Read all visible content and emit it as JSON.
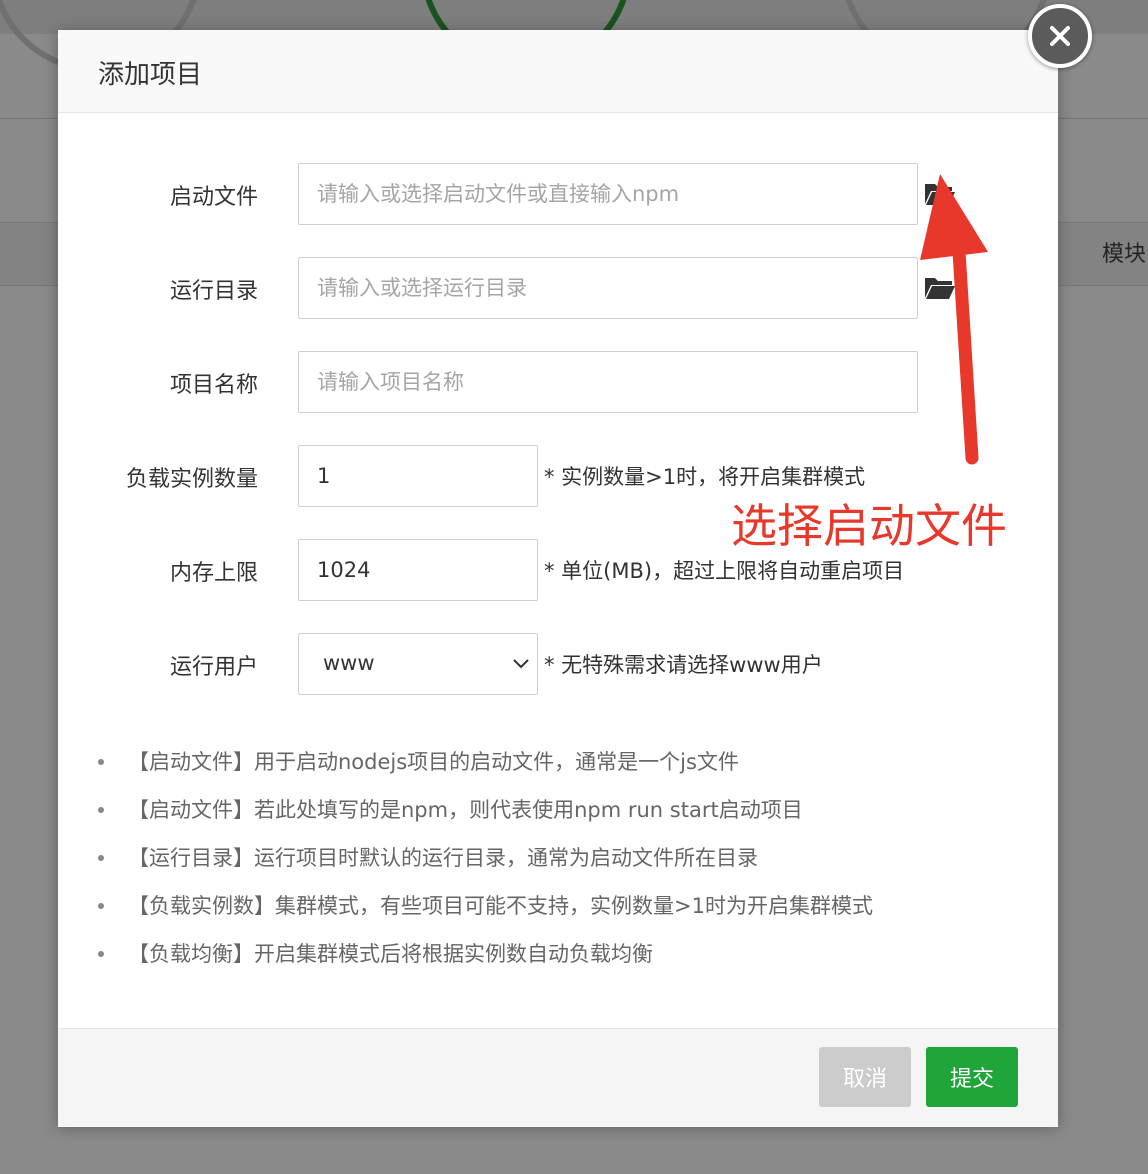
{
  "background": {
    "column_label": "模块"
  },
  "dialog": {
    "title": "添加项目",
    "close_icon": "close-icon"
  },
  "form": {
    "start_file": {
      "label": "启动文件",
      "placeholder": "请输入或选择启动文件或直接输入npm",
      "value": "",
      "icon": "folder-open-icon"
    },
    "run_dir": {
      "label": "运行目录",
      "placeholder": "请输入或选择运行目录",
      "value": "",
      "icon": "folder-open-icon"
    },
    "project_name": {
      "label": "项目名称",
      "placeholder": "请输入项目名称",
      "value": ""
    },
    "instances": {
      "label": "负载实例数量",
      "value": "1",
      "hint": "* 实例数量>1时，将开启集群模式"
    },
    "memory_limit": {
      "label": "内存上限",
      "value": "1024",
      "hint": "* 单位(MB)，超过上限将自动重启项目"
    },
    "run_user": {
      "label": "运行用户",
      "selected": "www",
      "hint": "* 无特殊需求请选择www用户"
    }
  },
  "tips": [
    "【启动文件】用于启动nodejs项目的启动文件，通常是一个js文件",
    "【启动文件】若此处填写的是npm，则代表使用npm run start启动项目",
    "【运行目录】运行项目时默认的运行目录，通常为启动文件所在目录",
    "【负载实例数】集群模式，有些项目可能不支持，实例数量>1时为开启集群模式",
    "【负载均衡】开启集群模式后将根据实例数自动负载均衡"
  ],
  "footer": {
    "cancel_label": "取消",
    "submit_label": "提交"
  },
  "annotation": {
    "text": "选择启动文件",
    "color": "#e8382b"
  },
  "colors": {
    "primary": "#20a53a",
    "cancel": "#cccccc"
  }
}
